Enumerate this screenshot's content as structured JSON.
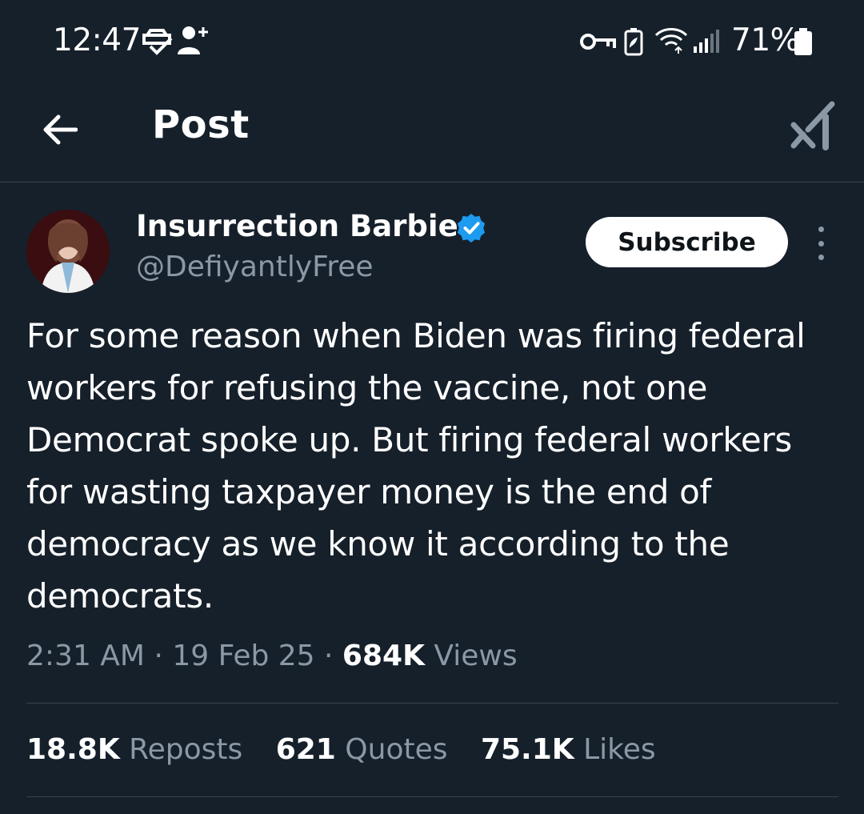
{
  "status_bar": {
    "time": "12:47",
    "battery_percent": "71%",
    "icons": [
      "carplay-icon",
      "person-add-icon",
      "vpn-key-icon",
      "battery-saver-icon",
      "wifi-icon",
      "signal-icon",
      "battery-icon"
    ]
  },
  "header": {
    "title": "Post",
    "back_icon": "arrow-left-icon",
    "grok_icon": "grok-icon"
  },
  "post": {
    "author_name": "Insurrection Barbie",
    "author_handle": "@DefiyantlyFree",
    "verified": true,
    "subscribe_label": "Subscribe",
    "text": "For some reason when Biden was firing federal workers for refusing the vaccine, not one Democrat spoke up. But firing federal workers for wasting taxpayer money is the end of democracy as we know it according to the democrats.",
    "time": "2:31 AM",
    "date": "19 Feb 25",
    "views_count": "684K",
    "views_label": "Views"
  },
  "stats": {
    "reposts_count": "18.8K",
    "reposts_label": "Reposts",
    "quotes_count": "621",
    "quotes_label": "Quotes",
    "likes_count": "75.1K",
    "likes_label": "Likes"
  },
  "colors": {
    "background": "#16202b",
    "primary_text": "#ffffff",
    "secondary_text": "#8b98a5",
    "divider": "#38444d",
    "verified_blue": "#1d9bf0"
  }
}
